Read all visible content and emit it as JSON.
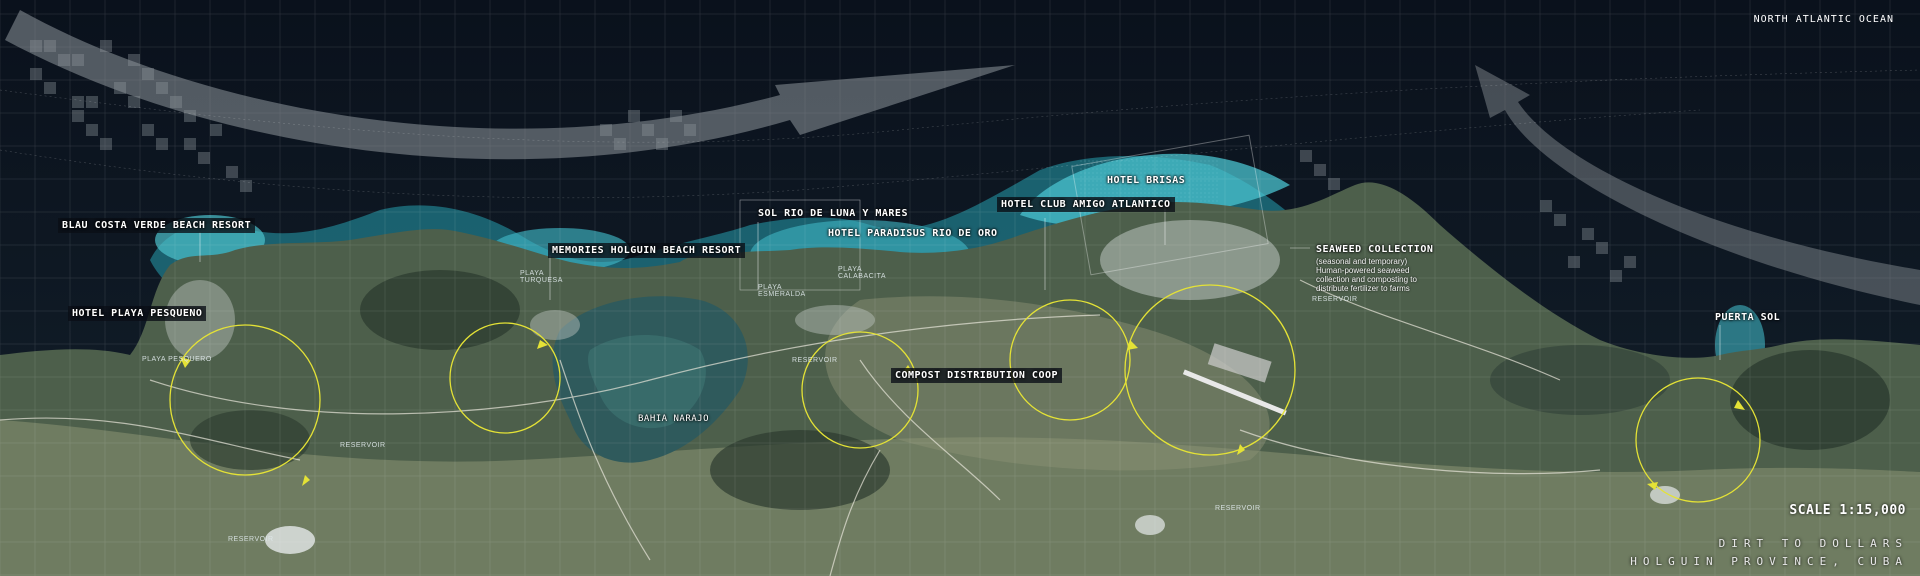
{
  "ocean_label": "NORTH ATLANTIC OCEAN",
  "scale_label": "SCALE 1:15,000",
  "title_line1": "DIRT TO DOLLARS",
  "title_line2": "HOLGUIN PROVINCE, CUBA",
  "places": {
    "blau": "BLAU COSTA VERDE BEACH RESORT",
    "pesqueno": "HOTEL PLAYA PESQUENO",
    "memories": "MEMORIES HOLGUIN BEACH RESORT",
    "sol": "SOL RIO DE LUNA Y MARES",
    "paradisus": "HOTEL PARADISUS RIO DE ORO",
    "brisas": "HOTEL BRISAS",
    "amigo": "HOTEL CLUB AMIGO ATLANTICO",
    "seaweed": "SEAWEED COLLECTION",
    "compost": "COMPOST DISTRIBUTION COOP",
    "puerta": "PUERTA SOL",
    "bahia": "BAHIA NARAJO"
  },
  "seaweed_desc_line1": "(seasonal and temporary)",
  "seaweed_desc_line2": "Human-powered seaweed collection and composting to distribute fertilizer to farms",
  "small_labels": {
    "playa_pesquero": "PLAYA",
    "playa_pesquero2": "PESQUERO",
    "playa_turquesa": "PLAYA",
    "playa_turquesa2": "TURQUESA",
    "playa_esmeralda": "PLAYA",
    "playa_esmeralda2": "ESMERALDA",
    "playa_calabacita": "PLAYA",
    "playa_calabacita2": "CALABACITA",
    "reservoir1": "RESERVOIR",
    "reservoir2": "RESERVOIR",
    "reservoir3": "RESERVOIR",
    "reservoir4": "RESERVOIR",
    "reservoir5": "RESERVOIR"
  },
  "colors": {
    "ocean": "#0b1320",
    "land": "#4d5f4b",
    "lagoon": "#3fb5c4",
    "reef": "#7fdbe3",
    "circle": "#e4e236",
    "grid": "#ffffff"
  }
}
